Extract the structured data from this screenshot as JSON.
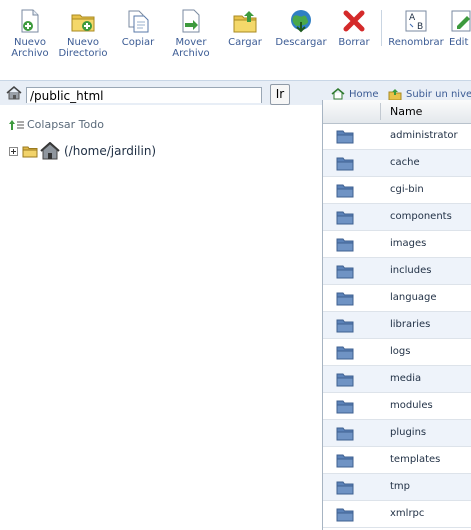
{
  "toolbar": {
    "buttons": [
      {
        "label": "Nuevo\nArchivo",
        "icon": "new-file-icon"
      },
      {
        "label": "Nuevo\nDirectorio",
        "icon": "new-folder-icon"
      },
      {
        "label": "Copiar",
        "icon": "copy-icon"
      },
      {
        "label": "Mover\nArchivo",
        "icon": "move-file-icon"
      },
      {
        "label": "Cargar",
        "icon": "upload-icon"
      },
      {
        "label": "Descargar",
        "icon": "download-icon"
      },
      {
        "label": "Borrar",
        "icon": "delete-icon"
      },
      {
        "label": "Renombrar",
        "icon": "rename-icon"
      },
      {
        "label": "Edit",
        "icon": "edit-icon"
      }
    ]
  },
  "address_bar": {
    "path_value": "/public_html",
    "go_label": "Ir",
    "home_label": "Home",
    "up_label": "Subir un nivel"
  },
  "tree": {
    "collapse_all_label": "Colapsar Todo",
    "root_label": "(/home/jardilin)"
  },
  "file_list": {
    "column_name": "Name",
    "items": [
      "administrator",
      "cache",
      "cgi-bin",
      "components",
      "images",
      "includes",
      "language",
      "libraries",
      "logs",
      "media",
      "modules",
      "plugins",
      "templates",
      "tmp",
      "xmlrpc"
    ]
  },
  "colors": {
    "label_blue": "#3b5b94",
    "address_bar_bg": "#e8eef6",
    "alt_row_bg": "#eef3fa",
    "folder_blue": "#6f93c4"
  }
}
